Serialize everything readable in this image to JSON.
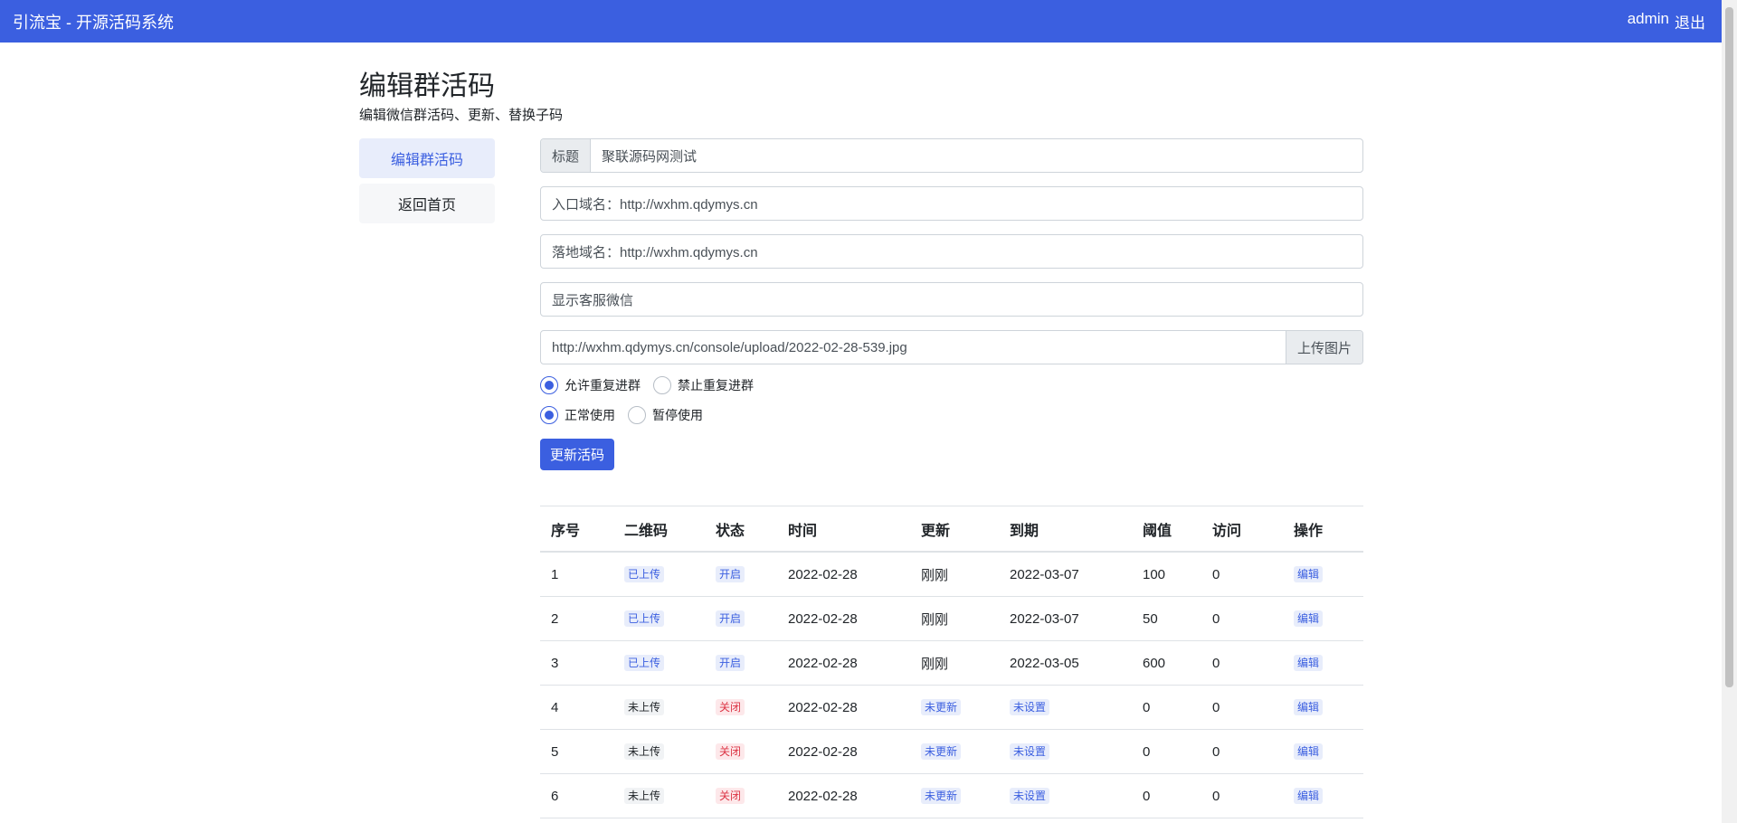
{
  "navbar": {
    "brand": "引流宝 - 开源活码系统",
    "user": "admin",
    "logout": "退出"
  },
  "page": {
    "title": "编辑群活码",
    "subtitle": "编辑微信群活码、更新、替换子码"
  },
  "sidebar": {
    "items": [
      {
        "label": "编辑群活码"
      },
      {
        "label": "返回首页"
      }
    ]
  },
  "form": {
    "title_label": "标题",
    "title_value": "聚联源码网测试",
    "entry_domain": "入口域名：http://wxhm.qdymys.cn",
    "landing_domain": "落地域名：http://wxhm.qdymys.cn",
    "service_wechat": "显示客服微信",
    "image_url": "http://wxhm.qdymys.cn/console/upload/2022-02-28-539.jpg",
    "upload_label": "上传图片",
    "radio_group1": [
      {
        "label": "允许重复进群"
      },
      {
        "label": "禁止重复进群"
      }
    ],
    "radio_group2": [
      {
        "label": "正常使用"
      },
      {
        "label": "暂停使用"
      }
    ],
    "submit_label": "更新活码"
  },
  "table": {
    "headers": [
      "序号",
      "二维码",
      "状态",
      "时间",
      "更新",
      "到期",
      "阈值",
      "访问",
      "操作"
    ],
    "rows": [
      {
        "no": "1",
        "qr": "已上传",
        "status": "开启",
        "time": "2022-02-28",
        "update": "刚刚",
        "expire": "2022-03-07",
        "threshold": "100",
        "visits": "0",
        "action": "编辑"
      },
      {
        "no": "2",
        "qr": "已上传",
        "status": "开启",
        "time": "2022-02-28",
        "update": "刚刚",
        "expire": "2022-03-07",
        "threshold": "50",
        "visits": "0",
        "action": "编辑"
      },
      {
        "no": "3",
        "qr": "已上传",
        "status": "开启",
        "time": "2022-02-28",
        "update": "刚刚",
        "expire": "2022-03-05",
        "threshold": "600",
        "visits": "0",
        "action": "编辑"
      },
      {
        "no": "4",
        "qr": "未上传",
        "status": "关闭",
        "time": "2022-02-28",
        "update": "未更新",
        "expire": "未设置",
        "threshold": "0",
        "visits": "0",
        "action": "编辑"
      },
      {
        "no": "5",
        "qr": "未上传",
        "status": "关闭",
        "time": "2022-02-28",
        "update": "未更新",
        "expire": "未设置",
        "threshold": "0",
        "visits": "0",
        "action": "编辑"
      },
      {
        "no": "6",
        "qr": "未上传",
        "status": "关闭",
        "time": "2022-02-28",
        "update": "未更新",
        "expire": "未设置",
        "threshold": "0",
        "visits": "0",
        "action": "编辑"
      }
    ]
  }
}
